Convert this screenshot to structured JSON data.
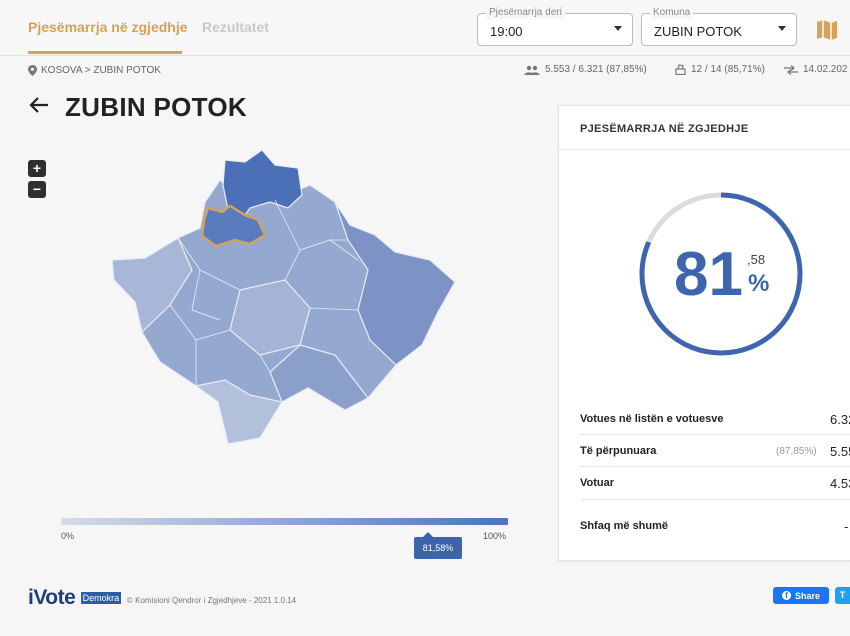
{
  "tabs": {
    "participation": "Pjesëmarrja në zgjedhje",
    "results": "Rezultatet"
  },
  "filters": {
    "time_label": "Pjesëmarrja deri",
    "time_value": "19:00",
    "commune_label": "Komuna",
    "commune_value": "ZUBIN POTOK"
  },
  "breadcrumb": "KOSOVA > ZUBIN POTOK",
  "stats": {
    "turnout": "5.553 / 6.321 (87,85%)",
    "stations": "12 / 14 (85,71%)",
    "date": "14.02.202"
  },
  "page_title": "ZUBIN POTOK",
  "zoom": {
    "in": "+",
    "out": "−"
  },
  "scale": {
    "min": "0%",
    "max": "100%",
    "marker": "81,58%",
    "marker_fraction": 0.8158
  },
  "card": {
    "title": "PJESËMARRJA NË ZGJEDHJE",
    "percent_int": "81",
    "percent_dec": ",58",
    "percent_sign": "%",
    "fraction": 0.8158,
    "rows": [
      {
        "label": "Votues në listën e votuesve",
        "extra": "",
        "value": "6.32"
      },
      {
        "label": "Të përpunuara",
        "extra": "(87,85%)",
        "value": "5.55"
      },
      {
        "label": "Votuar",
        "extra": "",
        "value": "4.53"
      }
    ],
    "more": "Shfaq më shumë",
    "more_value": "-"
  },
  "footer": {
    "logo": "iVote",
    "logo_badge": "Demokra",
    "copyright": "© Komisioni Qendror i Zgjedhjeve - 2021 1.0.14",
    "share": "Share",
    "tweet": "T"
  },
  "colors": {
    "accent": "#d3a25c",
    "primary": "#3d66ae",
    "highlight_border": "#d3a25c",
    "map_light": "#9fb0d2",
    "map_dark": "#4b70b7"
  }
}
